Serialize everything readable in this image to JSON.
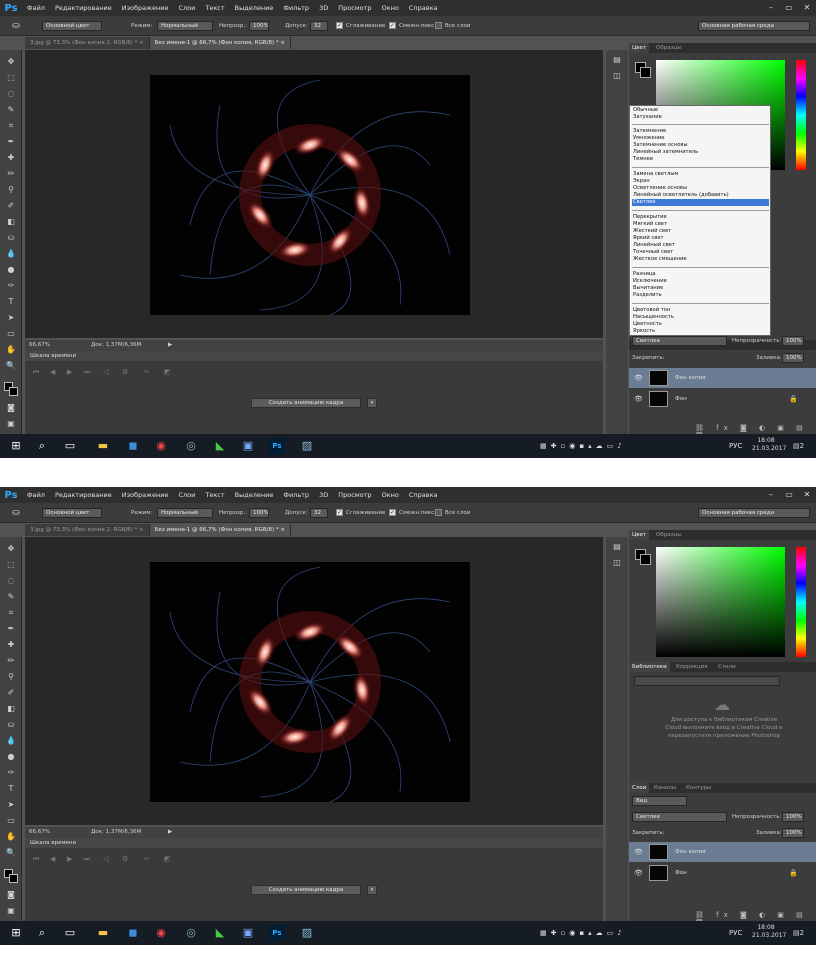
{
  "app": {
    "logo": "Ps",
    "menu": [
      "Файл",
      "Редактирование",
      "Изображение",
      "Слои",
      "Текст",
      "Выделение",
      "Фильтр",
      "3D",
      "Просмотр",
      "Окно",
      "Справка"
    ],
    "win_controls": [
      "–",
      "▭",
      "✕"
    ]
  },
  "options": {
    "source": "Основной цвет",
    "mode_label": "Режим:",
    "mode_value": "Нормальный",
    "opacity_label": "Непрозр.:",
    "opacity_value": "100%",
    "tolerance_label": "Допуск:",
    "tolerance_value": "32",
    "antialias": "Сглаживание",
    "contiguous": "Смежн.пикс",
    "all_layers": "Все слои",
    "workspace": "Основная рабочая среда"
  },
  "tabs": [
    {
      "label": "3.jpg @ 73,3% (Фон копия 2, RGB/8) *",
      "close": "×"
    },
    {
      "label": "Без имени-1 @ 66,7% (Фон копия, RGB/8) *",
      "close": "×"
    }
  ],
  "status": {
    "zoom": "66,67%",
    "doc": "Док: 1,37М/6,36М"
  },
  "timeline": {
    "title": "Шкала времени",
    "create_button": "Создать анимацию кадра",
    "arrow": "▾"
  },
  "panels": {
    "color_tab": "Цвет",
    "swatches_tab": "Образцы",
    "lib_tabs": [
      "Библиотеки",
      "Коррекция",
      "Стили"
    ],
    "lib_message": "Для доступа к библиотекам Creative Cloud выполните вход в Creative Cloud и перезапустите приложение Photoshop",
    "layer_tabs": [
      "Слои",
      "Каналы",
      "Контуры"
    ],
    "filter": "Вид",
    "blend": "Светлее",
    "opacity_label": "Непрозрачность:",
    "opacity_value": "100%",
    "lock_label": "Закрепить:",
    "fill_label": "Заливка:",
    "fill_value": "100%",
    "layers": [
      {
        "name": "Фон копия"
      },
      {
        "name": "Фон"
      }
    ]
  },
  "blend_menu": {
    "groups": [
      [
        "Обычные",
        "Затухание"
      ],
      [
        "Затемнение",
        "Умножение",
        "Затемнение основы",
        "Линейный затемнитель",
        "Темнее"
      ],
      [
        "Замена светлым",
        "Экран",
        "Осветление основы",
        "Линейный осветлитель (добавить)",
        "Светлее"
      ],
      [
        "Перекрытие",
        "Мягкий свет",
        "Жесткий свет",
        "Яркий свет",
        "Линейный свет",
        "Точечный свет",
        "Жесткое смешение"
      ],
      [
        "Разница",
        "Исключение",
        "Вычитание",
        "Разделить"
      ],
      [
        "Цветовой тон",
        "Насыщенность",
        "Цветность",
        "Яркость"
      ]
    ],
    "selected": "Светлее"
  },
  "taskbar": {
    "lang": "РУС",
    "time": "18:08",
    "date": "21.03.2017",
    "ps": "Ps",
    "notif": "2"
  },
  "colors": {
    "accent": "#31a8ff",
    "selected_layer": "#6b7d93",
    "menu_highlight": "#3c78d8"
  }
}
